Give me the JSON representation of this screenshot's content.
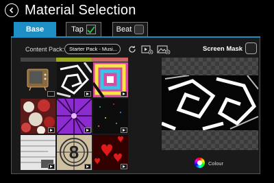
{
  "header": {
    "title": "Material Selection"
  },
  "tabs": [
    {
      "label": "Base",
      "state": "active"
    },
    {
      "label": "Tap",
      "state": "checked"
    },
    {
      "label": "Beat",
      "state": "unchecked"
    }
  ],
  "content_pack": {
    "label": "Content Pack:",
    "value": "Starter Pack - Musi..."
  },
  "screen_mask": {
    "label": "Screen Mask"
  },
  "colour": {
    "label": "Colour"
  },
  "colors": {
    "accent": "#1e8fc4"
  },
  "grid": {
    "tiles": [
      {
        "kind": "image",
        "icon": "tv-icon"
      },
      {
        "kind": "video",
        "icon": "swirl-pattern"
      },
      {
        "kind": "video",
        "icon": "color-swirl-pattern"
      },
      {
        "kind": "video",
        "icon": "rose-pattern"
      },
      {
        "kind": "video",
        "icon": "purple-rays-pattern"
      },
      {
        "kind": "video",
        "icon": "dark-speckle-pattern"
      },
      {
        "kind": "video",
        "icon": "white-noise-pattern"
      },
      {
        "kind": "video",
        "icon": "film-countdown-pattern"
      },
      {
        "kind": "video",
        "icon": "hearts-pattern"
      }
    ]
  }
}
